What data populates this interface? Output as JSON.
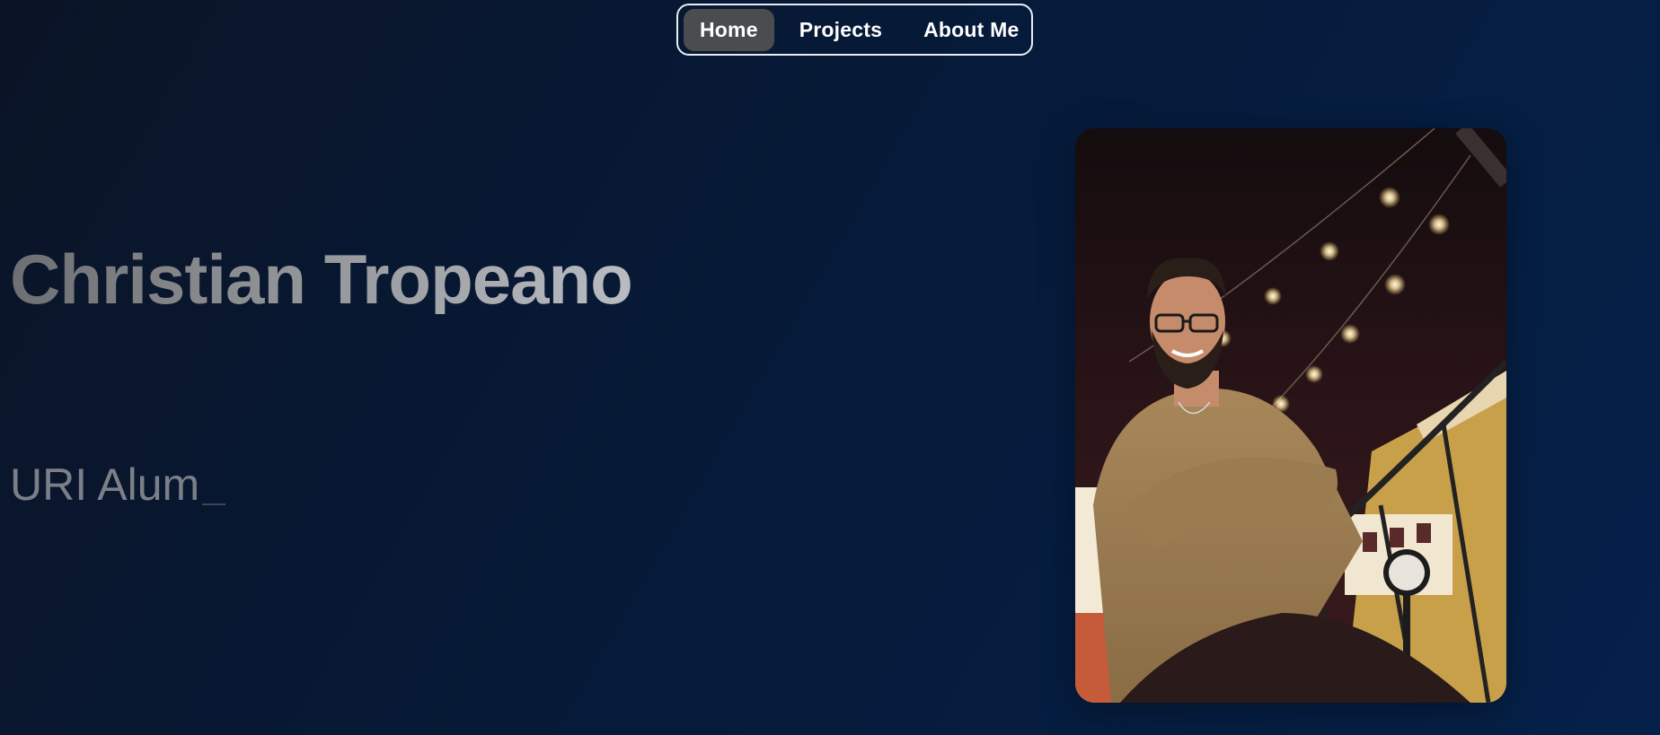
{
  "nav": {
    "items": [
      {
        "label": "Home",
        "active": true
      },
      {
        "label": "Projects",
        "active": false
      },
      {
        "label": "About Me",
        "active": false
      }
    ]
  },
  "hero": {
    "title": "Christian Tropeano",
    "subtitle": "URI Alum"
  },
  "photo": {
    "subject": "portrait-photo"
  },
  "colors": {
    "background_start": "#0b1426",
    "background_end": "#05214a",
    "nav_active": "#4b4c4e",
    "nav_border": "#e9eef5"
  }
}
